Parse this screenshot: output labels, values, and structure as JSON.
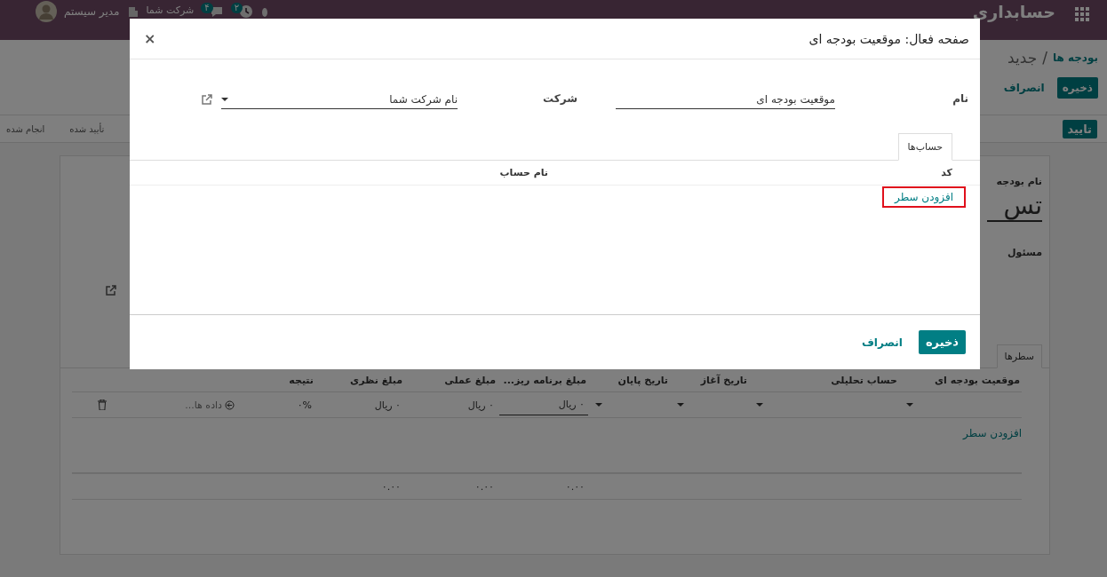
{
  "navbar": {
    "app_title": "حسابداری",
    "user": "مدیر سیستم",
    "company": "شرکت شما",
    "badges": [
      {
        "kind": "activity",
        "count": "۲"
      },
      {
        "kind": "chat",
        "count": "۴"
      }
    ]
  },
  "control_panel": {
    "separator": "/",
    "breadcrumb": [
      {
        "label": "بودجه ها",
        "kind": "link"
      },
      {
        "label": "جدید",
        "kind": "current"
      }
    ],
    "buttons": [
      {
        "label": "ذخیره",
        "kind": "primary"
      },
      {
        "label": "انصراف",
        "kind": "secondary"
      }
    ]
  },
  "status_bar": {
    "action": "تایید",
    "stages": [
      {
        "label": "تأیید شده",
        "selected": false
      },
      {
        "label": "انجام شده",
        "selected": false
      }
    ]
  },
  "form": {
    "name_label": "نام بودجه",
    "name_value": "تس",
    "responsible_label": "مسئول",
    "tabs": [
      {
        "label": "سطرها",
        "selected": true
      }
    ],
    "columns": [
      {
        "label": "موقعیت بودجه ای"
      },
      {
        "label": "حساب تحلیلی"
      },
      {
        "label": "تاریخ آغاز"
      },
      {
        "label": "تاریخ پایان"
      },
      {
        "label": "مبلغ برنامه ریز...",
        "total": "۰.۰۰"
      },
      {
        "label": "مبلغ عملی",
        "total": "۰.۰۰"
      },
      {
        "label": "مبلغ نظری",
        "total": "۰.۰۰"
      },
      {
        "label": "نتیجه"
      }
    ],
    "rows": [
      {
        "cells": [
          {
            "kind": "select"
          },
          {
            "kind": "select"
          },
          {
            "kind": "select"
          },
          {
            "kind": "select"
          },
          {
            "kind": "input",
            "value": "۰ ریال"
          },
          {
            "kind": "text",
            "value": "۰ ریال"
          },
          {
            "kind": "text",
            "value": "۰ ریال"
          },
          {
            "kind": "text",
            "value": "۰%"
          }
        ],
        "analytic": "داده ها..."
      }
    ],
    "add_line": "افزودن سطر"
  },
  "dialog": {
    "title": "صفحه فعال: موقعیت بودجه ای",
    "close": "×",
    "fields": [
      {
        "label": "نام",
        "value": "موقعیت بودجه ای",
        "kind": "input"
      },
      {
        "label": "شرکت",
        "value": "نام شرکت شما",
        "kind": "select"
      }
    ],
    "tabs": [
      {
        "label": "حساب‌ها",
        "selected": true
      }
    ],
    "columns": [
      "کد",
      "نام حساب"
    ],
    "add_line": {
      "label": "افزودن سطر",
      "highlighted": true
    },
    "buttons": [
      {
        "label": "ذخیره",
        "kind": "primary"
      },
      {
        "label": "انصراف",
        "kind": "secondary"
      }
    ]
  }
}
